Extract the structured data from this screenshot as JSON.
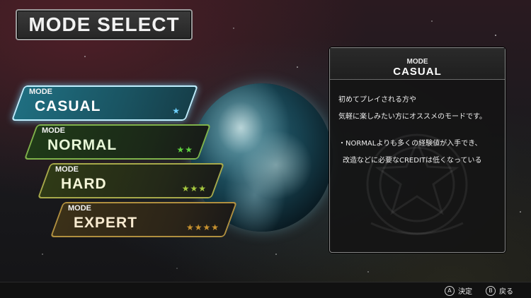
{
  "title": "MODE SELECT",
  "modes": [
    {
      "tag": "MODE",
      "name": "CASUAL",
      "difficulty": "★",
      "selected": true
    },
    {
      "tag": "MODE",
      "name": "NORMAL",
      "difficulty": "★★",
      "selected": false
    },
    {
      "tag": "MODE",
      "name": "HARD",
      "difficulty": "★★★",
      "selected": false
    },
    {
      "tag": "MODE",
      "name": "EXPERT",
      "difficulty": "★★★★",
      "selected": false
    }
  ],
  "detail": {
    "label": "MODE",
    "title": "CASUAL",
    "line1": "初めてプレイされる方や",
    "line2": "気軽に楽しみたい方にオススメのモードです。",
    "note1": "・NORMALよりも多くの経験値が入手でき、",
    "note2": "改造などに必要なCREDITは低くなっている"
  },
  "footer": {
    "confirm": {
      "glyph": "A",
      "label": "決定"
    },
    "back": {
      "glyph": "B",
      "label": "戻る"
    }
  },
  "colors": {
    "casual": "#6fd1ff",
    "normal": "#5fd03f",
    "hard": "#a6c83f",
    "expert": "#c8922f"
  }
}
